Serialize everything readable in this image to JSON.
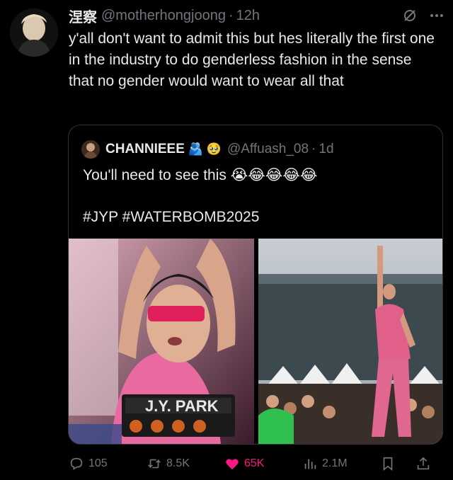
{
  "tweet": {
    "author_name": "涅察",
    "handle": "@motherhongjoong",
    "dot": "·",
    "time": "12h",
    "text": "y'all don't want to admit this but hes literally the first one in the industry to do genderless fashion in the sense that no gender would want to wear all that"
  },
  "quote": {
    "name": "CHANNIEEE",
    "emoji_badges": "🫂 🥹",
    "handle": "@Affuash_08",
    "dot": "·",
    "time": "1d",
    "text": "You'll need to see this 😭😂😂😂😂",
    "hashtags": "#JYP #WATERBOMB2025",
    "stage_sign": "J.Y. PARK"
  },
  "actions": {
    "replies": "105",
    "retweets": "8.5K",
    "likes": "65K",
    "views": "2.1M"
  },
  "colors": {
    "background": "#000000",
    "text": "#e7e9ea",
    "muted": "#71767b",
    "like": "#f91880",
    "border": "#2f3336"
  },
  "icons": [
    "avatar",
    "no-cache-icon",
    "more-icon",
    "reply-icon",
    "retweet-icon",
    "like-icon",
    "views-icon",
    "bookmark-icon",
    "share-icon"
  ]
}
